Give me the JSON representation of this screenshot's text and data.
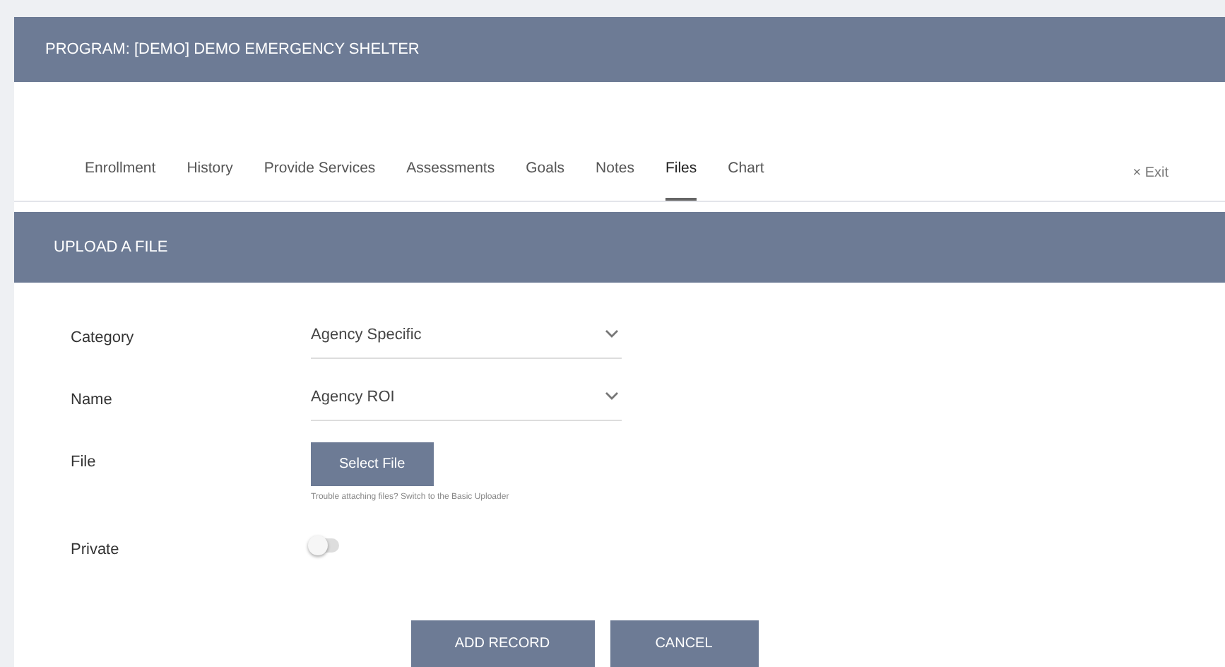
{
  "program_title": "PROGRAM: [DEMO] DEMO EMERGENCY SHELTER",
  "tabs": [
    {
      "label": "Enrollment",
      "selected": false
    },
    {
      "label": "History",
      "selected": false
    },
    {
      "label": "Provide Services",
      "selected": false
    },
    {
      "label": "Assessments",
      "selected": false
    },
    {
      "label": "Goals",
      "selected": false
    },
    {
      "label": "Notes",
      "selected": false
    },
    {
      "label": "Files",
      "selected": true
    },
    {
      "label": "Chart",
      "selected": false
    }
  ],
  "exit": {
    "icon": "×",
    "label": "Exit"
  },
  "section_title": "UPLOAD A FILE",
  "fields": [
    {
      "kind": "select",
      "label": "Category",
      "value": "Agency Specific"
    },
    {
      "kind": "select",
      "label": "Name",
      "value": "Agency ROI"
    },
    {
      "kind": "file",
      "label": "File",
      "button": "Select File",
      "help": "Trouble attaching files? Switch to the Basic Uploader"
    },
    {
      "kind": "switch",
      "label": "Private",
      "on": false
    }
  ],
  "buttons": [
    "ADD RECORD",
    "CANCEL"
  ]
}
